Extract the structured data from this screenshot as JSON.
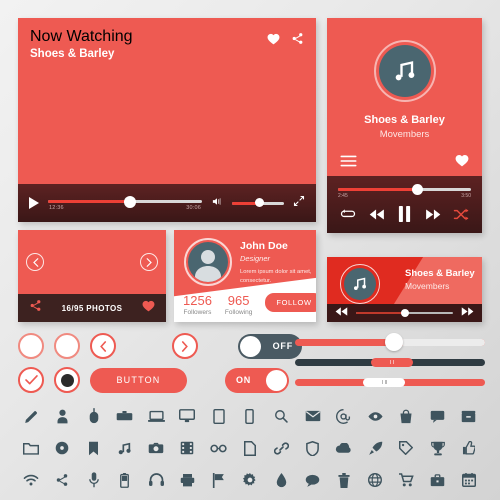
{
  "theme": {
    "accent": "#ee5a52",
    "accent_dark": "#e02b20",
    "dark_panel": "#3a1717",
    "disc": "#4a6670",
    "toggle_off_bg": "#4a5a63",
    "slider_dark": "#2f3b42",
    "icon_color": "#3f545e",
    "background": "#e8e8e8"
  },
  "video_player": {
    "now_watching_label": "Now Watching",
    "title": "Shoes & Barley",
    "like_icon": "heart-icon",
    "share_icon": "share-icon",
    "play_icon": "play-icon",
    "time_elapsed": "12:36",
    "time_total": "30:06",
    "progress_percent": 53,
    "volume_icon": "volume-icon",
    "volume_percent": 52,
    "fullscreen_icon": "fullscreen-icon"
  },
  "music_player": {
    "album_icon": "music-note-icon",
    "title": "Shoes & Barley",
    "artist": "Movembers",
    "menu_icon": "hamburger-menu-icon",
    "like_icon": "heart-icon",
    "time_elapsed": "2:45",
    "time_total": "3:50",
    "progress_percent": 60,
    "controls": [
      {
        "name": "repeat-icon"
      },
      {
        "name": "rewind-icon"
      },
      {
        "name": "pause-icon"
      },
      {
        "name": "forward-icon"
      },
      {
        "name": "shuffle-icon"
      }
    ]
  },
  "gallery_card": {
    "prev_icon": "chevron-left-icon",
    "next_icon": "chevron-right-icon",
    "share_icon": "share-icon",
    "count_label": "16/95 PHOTOS",
    "like_icon": "heart-icon"
  },
  "profile_card": {
    "avatar_icon": "user-avatar-icon",
    "name": "John Doe",
    "role": "Designer",
    "bio": "Lorem ipsum dolor sit amet, consectetur.",
    "stats": [
      {
        "value": "1256",
        "label": "Followers"
      },
      {
        "value": "965",
        "label": "Following"
      }
    ],
    "follow_label": "FOLLOW"
  },
  "mini_player": {
    "album_icon": "music-note-icon",
    "title": "Shoes & Barley",
    "artist": "Movembers",
    "prev_icon": "rewind-icon",
    "next_icon": "forward-icon",
    "progress_percent": 50
  },
  "controls": {
    "checkbox_unchecked": "",
    "checkbox_checked_icon": "check-icon",
    "radio_unchecked": "",
    "radio_checked": "",
    "arrow_prev_icon": "chevron-left-icon",
    "arrow_next_icon": "chevron-right-icon",
    "button_label": "BUTTON",
    "toggle_off_label": "OFF",
    "toggle_on_label": "ON"
  },
  "sliders": [
    {
      "name": "slider-round-knob",
      "style": "red-round",
      "value_percent": 52
    },
    {
      "name": "slider-dark-pill",
      "style": "dark-red-pill",
      "value_percent": 45
    },
    {
      "name": "slider-red-pill",
      "style": "red-white-pill",
      "value_percent": 41
    }
  ],
  "icon_grid": {
    "rows": [
      [
        "pencil-icon",
        "user-icon",
        "mouse-icon",
        "keyboard-icon",
        "laptop-icon",
        "monitor-icon",
        "tablet-icon",
        "phone-icon",
        "search-icon",
        "envelope-icon",
        "at-sign-icon",
        "eye-icon",
        "bag-icon",
        "chat-icon",
        "archive-icon"
      ],
      [
        "folder-icon",
        "disc-icon",
        "bookmark-icon",
        "music-note-icon",
        "camera-icon",
        "film-icon",
        "glasses-icon",
        "file-icon",
        "link-icon",
        "shield-icon",
        "cloud-icon",
        "rocket-icon",
        "tag-icon",
        "trophy-icon",
        "thumbs-up-icon"
      ],
      [
        "wifi-icon",
        "share-icon",
        "microphone-icon",
        "battery-icon",
        "headphones-icon",
        "printer-icon",
        "flag-icon",
        "gear-icon",
        "drop-icon",
        "speech-bubble-icon",
        "trash-icon",
        "globe-icon",
        "cart-icon",
        "briefcase-icon",
        "calendar-icon"
      ]
    ]
  }
}
